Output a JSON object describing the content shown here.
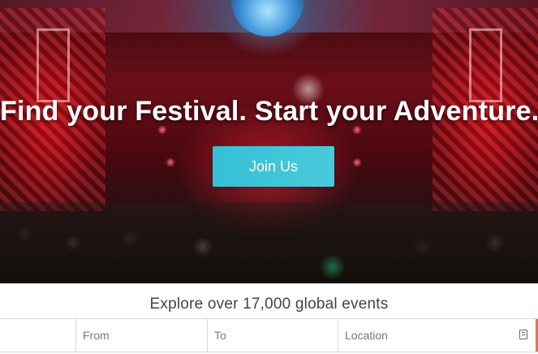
{
  "hero": {
    "title": "Find your Festival. Start your Adventure.",
    "cta_label": "Join Us",
    "cta_color": "#41c4d8"
  },
  "explore": {
    "text": "Explore over 17,000 global events"
  },
  "search": {
    "first_placeholder": "",
    "from_placeholder": "From",
    "to_placeholder": "To",
    "location_placeholder": "Location",
    "location_icon": "calendar-icon",
    "accent_color": "#e0745a"
  }
}
